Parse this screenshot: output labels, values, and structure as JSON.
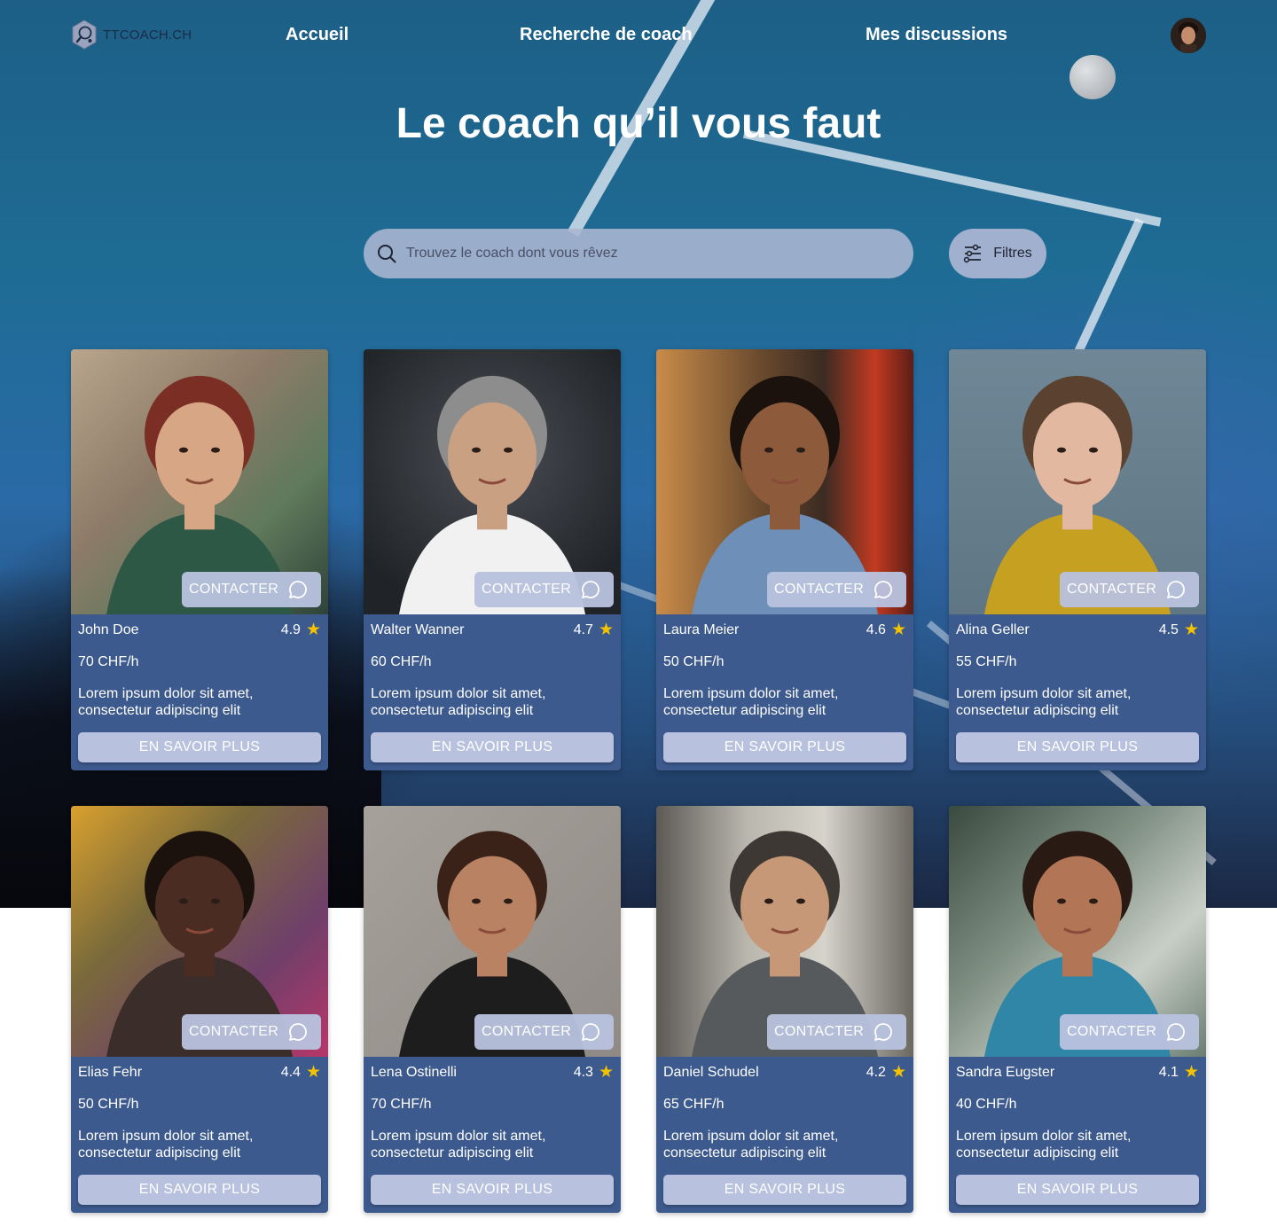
{
  "brand": {
    "name": "TTCOACH.CH"
  },
  "nav": {
    "links": [
      "Accueil",
      "Recherche de coach",
      "Mes discussions"
    ]
  },
  "hero": {
    "title": "Le coach qu’il vous faut"
  },
  "search": {
    "placeholder": "Trouvez le coach dont vous rêvez"
  },
  "filters": {
    "label": "Filtres"
  },
  "labels": {
    "contact": "CONTACTER",
    "more": "EN SAVOIR PLUS"
  },
  "coaches": [
    {
      "name": "John Doe",
      "rating": "4.9",
      "price": "70 CHF/h",
      "description": "Lorem ipsum dolor sit amet, consectetur adipiscing elit"
    },
    {
      "name": "Walter Wanner",
      "rating": "4.7",
      "price": "60 CHF/h",
      "description": "Lorem ipsum dolor sit amet, consectetur adipiscing elit"
    },
    {
      "name": "Laura Meier",
      "rating": "4.6",
      "price": "50 CHF/h",
      "description": "Lorem ipsum dolor sit amet, consectetur adipiscing elit"
    },
    {
      "name": "Alina Geller",
      "rating": "4.5",
      "price": "55 CHF/h",
      "description": "Lorem ipsum dolor sit amet, consectetur adipiscing elit"
    },
    {
      "name": "Elias Fehr",
      "rating": "4.4",
      "price": "50 CHF/h",
      "description": "Lorem ipsum dolor sit amet, consectetur adipiscing elit"
    },
    {
      "name": "Lena Ostinelli",
      "rating": "4.3",
      "price": "70 CHF/h",
      "description": "Lorem ipsum dolor sit amet, consectetur adipiscing elit"
    },
    {
      "name": "Daniel Schudel",
      "rating": "4.2",
      "price": "65 CHF/h",
      "description": "Lorem ipsum dolor sit amet, consectetur adipiscing elit"
    },
    {
      "name": "Sandra Eugster",
      "rating": "4.1",
      "price": "40 CHF/h",
      "description": "Lorem ipsum dolor sit amet, consectetur adipiscing elit"
    }
  ],
  "colors": {
    "card_body": "#3d5a8e",
    "button": "#b8c2de",
    "star": "#f3c300",
    "search_bg": "#acb6d2"
  },
  "icons": {
    "search": "search-icon",
    "filters": "sliders-icon",
    "contact": "chat-bubble-icon",
    "rating": "star-icon"
  }
}
